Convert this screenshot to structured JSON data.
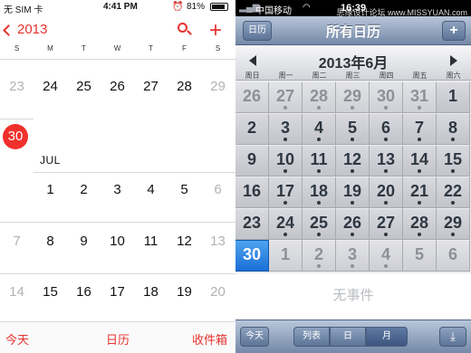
{
  "left": {
    "status": {
      "carrier": "无 SIM 卡",
      "time": "4:41 PM",
      "battery": "81%"
    },
    "nav": {
      "back_label": "2013"
    },
    "weekdays": [
      "S",
      "M",
      "T",
      "W",
      "T",
      "F",
      "S"
    ],
    "row_june": [
      "23",
      "24",
      "25",
      "26",
      "27",
      "28",
      "29"
    ],
    "today": "30",
    "month_label": "JUL",
    "row1": [
      "",
      "1",
      "2",
      "3",
      "4",
      "5",
      "6"
    ],
    "row2": [
      "7",
      "8",
      "9",
      "10",
      "11",
      "12",
      "13"
    ],
    "row3": [
      "14",
      "15",
      "16",
      "17",
      "18",
      "19",
      "20"
    ],
    "tabbar": {
      "today": "今天",
      "calendars": "日历",
      "inbox": "收件箱"
    },
    "accent": "#e5322d"
  },
  "right": {
    "status": {
      "carrier": "中国移动",
      "time": "16:39",
      "watermark": "思缘设计论坛 www.MISSYUAN.com"
    },
    "nav": {
      "left_button": "日历",
      "title": "所有日历",
      "add": "+"
    },
    "month_title": "2013年6月",
    "weekdays": [
      "周日",
      "周一",
      "周二",
      "周三",
      "周四",
      "周五",
      "周六"
    ],
    "weeks": [
      [
        "26",
        "27",
        "28",
        "29",
        "30",
        "31",
        "1"
      ],
      [
        "2",
        "3",
        "4",
        "5",
        "6",
        "7",
        "8"
      ],
      [
        "9",
        "10",
        "11",
        "12",
        "13",
        "14",
        "15"
      ],
      [
        "16",
        "17",
        "18",
        "19",
        "20",
        "21",
        "22"
      ],
      [
        "23",
        "24",
        "25",
        "26",
        "27",
        "28",
        "29"
      ],
      [
        "30",
        "1",
        "2",
        "3",
        "4",
        "5",
        "6"
      ]
    ],
    "no_events": "无事件",
    "toolbar": {
      "today": "今天",
      "list": "列表",
      "day": "日",
      "month": "月"
    },
    "accent": "#1b6ed6"
  }
}
